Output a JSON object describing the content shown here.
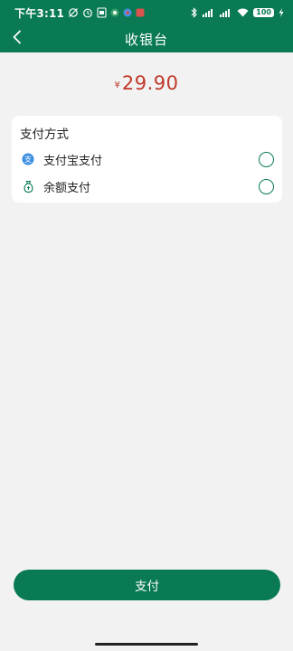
{
  "status_bar": {
    "time": "下午3:11",
    "battery": "100",
    "icons": [
      "alarm-off-icon",
      "alarm-clock-icon",
      "sim-icon",
      "app-badge-icon",
      "app-badge-icon",
      "app-badge-icon",
      "bluetooth-icon",
      "signal-icon",
      "signal-icon",
      "wifi-icon",
      "battery-icon",
      "charging-icon"
    ]
  },
  "header": {
    "title": "收银台",
    "back_icon": "chevron-left-icon"
  },
  "amount": {
    "currency_symbol": "¥",
    "value": "29.90",
    "color": "#c0392b"
  },
  "payment": {
    "section_title": "支付方式",
    "methods": [
      {
        "label": "支付宝支付",
        "icon": "alipay-icon",
        "selected": false
      },
      {
        "label": "余额支付",
        "icon": "money-bag-icon",
        "selected": false
      }
    ]
  },
  "footer": {
    "pay_label": "支付"
  },
  "colors": {
    "primary": "#0a7a55",
    "background": "#f2f2f2",
    "price": "#c0392b"
  }
}
